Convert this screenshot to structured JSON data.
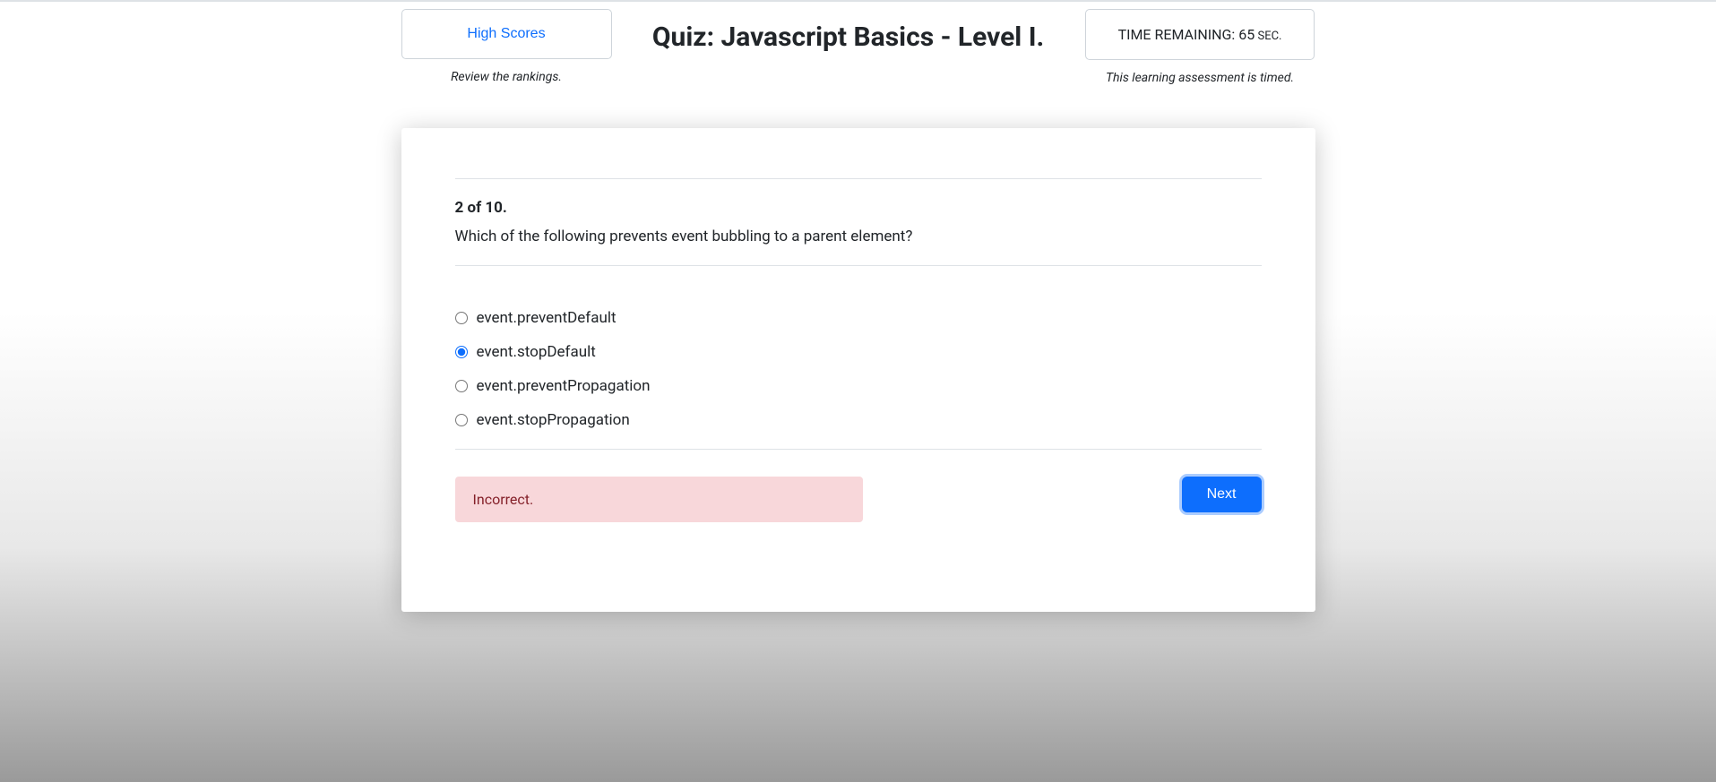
{
  "header": {
    "high_scores_label": "High Scores",
    "high_scores_helper": "Review the rankings.",
    "title": "Quiz: Javascript Basics - Level I.",
    "time_remaining_prefix": "TIME REMAINING: ",
    "time_remaining_value": "65",
    "time_remaining_suffix": " SEC.",
    "timed_helper": "This learning assessment is timed."
  },
  "question": {
    "number": "2 of 10.",
    "text": "Which of the following prevents event bubbling to a parent element?",
    "options": [
      {
        "label": "event.preventDefault",
        "selected": false
      },
      {
        "label": "event.stopDefault",
        "selected": true
      },
      {
        "label": "event.preventPropagation",
        "selected": false
      },
      {
        "label": "event.stopPropagation",
        "selected": false
      }
    ]
  },
  "result": {
    "text": "Incorrect."
  },
  "buttons": {
    "next": "Next"
  }
}
